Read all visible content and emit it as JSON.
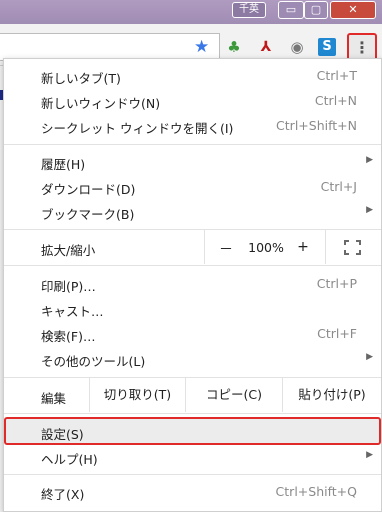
{
  "window": {
    "ime_label": "千英",
    "minimize_glyph": "▭",
    "maximize_glyph": "▢",
    "close_glyph": "✕"
  },
  "toolbar": {
    "bookmark_icon": "star-icon",
    "extensions": [
      "clover-extension-icon",
      "acrobat-extension-icon",
      "camera-extension-icon",
      "s-extension-icon"
    ],
    "acrobat_glyph": "⅄",
    "camera_glyph": "◉",
    "s_glyph": "S",
    "clover_glyph": "♣",
    "menu_glyph": "⋮"
  },
  "menu": {
    "new_tab": {
      "label": "新しいタブ(T)",
      "shortcut": "Ctrl+T"
    },
    "new_window": {
      "label": "新しいウィンドウ(N)",
      "shortcut": "Ctrl+N"
    },
    "incognito": {
      "label": "シークレット ウィンドウを開く(I)",
      "shortcut": "Ctrl+Shift+N"
    },
    "history": {
      "label": "履歴(H)"
    },
    "downloads": {
      "label": "ダウンロード(D)",
      "shortcut": "Ctrl+J"
    },
    "bookmarks": {
      "label": "ブックマーク(B)"
    },
    "zoom": {
      "label": "拡大/縮小",
      "minus": "－",
      "value": "100%",
      "plus": "+"
    },
    "print": {
      "label": "印刷(P)…",
      "shortcut": "Ctrl+P"
    },
    "cast": {
      "label": "キャスト…"
    },
    "find": {
      "label": "検索(F)…",
      "shortcut": "Ctrl+F"
    },
    "more_tools": {
      "label": "その他のツール(L)"
    },
    "edit": {
      "label": "編集",
      "cut": "切り取り(T)",
      "copy": "コピー(C)",
      "paste": "貼り付け(P)"
    },
    "settings": {
      "label": "設定(S)"
    },
    "help": {
      "label": "ヘルプ(H)"
    },
    "exit": {
      "label": "終了(X)",
      "shortcut": "Ctrl+Shift+Q"
    }
  },
  "colors": {
    "highlight_border": "#e02a2a",
    "titlebar": "#a08db4",
    "star": "#3b78e7"
  }
}
